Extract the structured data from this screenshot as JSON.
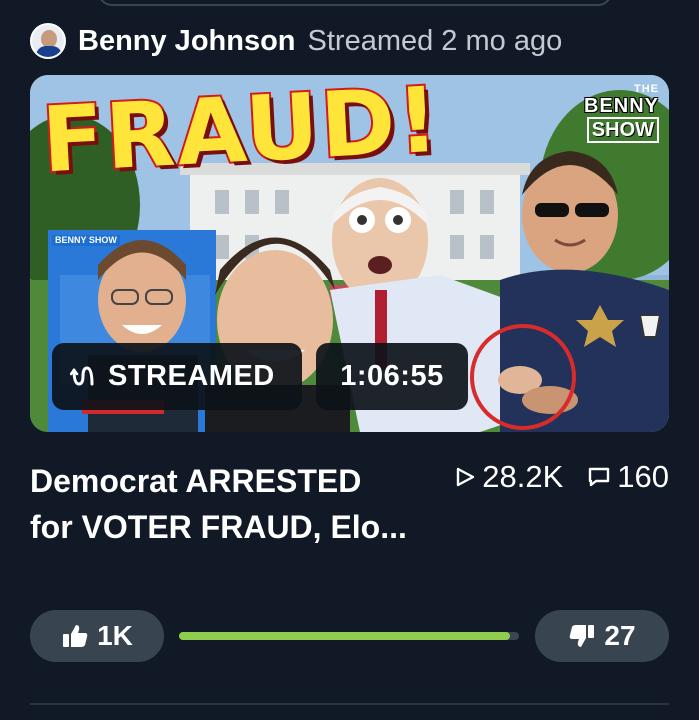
{
  "channel": {
    "name": "Benny Johnson",
    "meta": "Streamed 2 mo ago"
  },
  "thumbnail": {
    "headline": "FRAUD!",
    "brand_the": "THE",
    "brand_name": "BENNY",
    "brand_show": "SHOW",
    "inset_logo": "BENNY SHOW",
    "status_badge": "STREAMED",
    "duration": "1:06:55"
  },
  "video": {
    "title": "Democrat ARRESTED for VOTER FRAUD, Elo...",
    "views": "28.2K",
    "comments": "160"
  },
  "rating": {
    "likes_label": "1K",
    "dislikes_label": "27",
    "like_ratio": 0.974
  },
  "colors": {
    "background": "#101925",
    "button_bg": "#394451",
    "ratio_fill": "#8fce4c",
    "fraud_text": "#ffe53a",
    "circle_annotation": "#d92b2b"
  },
  "icons": {
    "views": "play-outline-icon",
    "comments": "comment-bubble-icon",
    "like": "thumbs-up-icon",
    "dislike": "thumbs-down-icon",
    "streamed": "stream-waves-icon"
  }
}
